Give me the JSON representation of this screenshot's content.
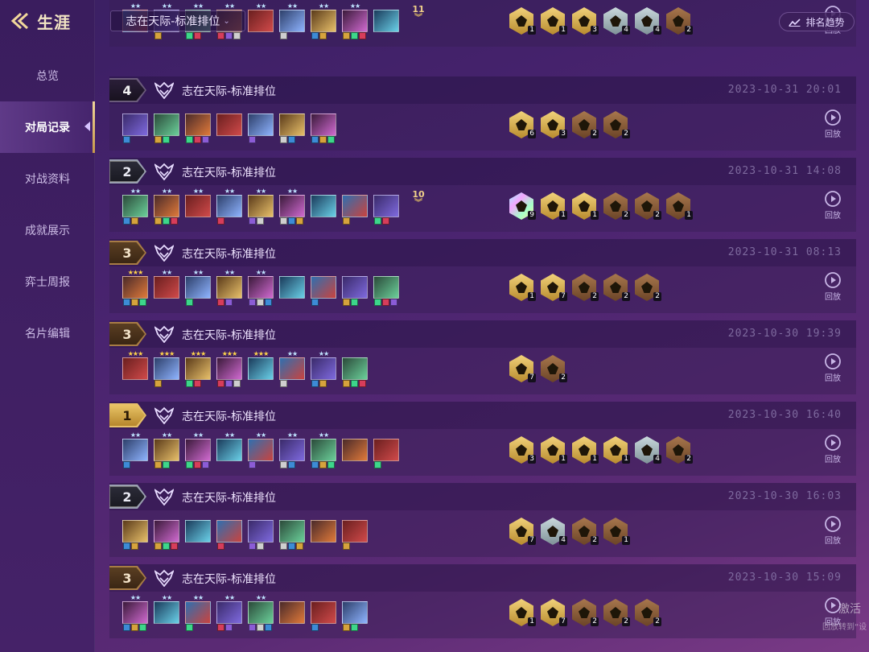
{
  "header": {
    "back_title": "生涯"
  },
  "sidebar": {
    "items": [
      {
        "label": "总览",
        "active": false
      },
      {
        "label": "对局记录",
        "active": true
      },
      {
        "label": "对战资料",
        "active": false
      },
      {
        "label": "成就展示",
        "active": false
      },
      {
        "label": "弈士周报",
        "active": false
      },
      {
        "label": "名片编辑",
        "active": false
      }
    ]
  },
  "topbar": {
    "mode_select": "志在天际-标准排位",
    "trend_button": "排名趋势"
  },
  "replay_label": "回放",
  "matches": [
    {
      "rank": "",
      "mode": "",
      "time": "",
      "units": [
        {
          "stars": 2
        },
        {
          "stars": 2
        },
        {
          "stars": 2
        },
        {
          "stars": 2
        },
        {
          "stars": 2
        },
        {
          "stars": 2
        },
        {
          "stars": 2
        },
        {
          "stars": 2
        },
        {
          "stars": 0
        }
      ],
      "overflow": "11",
      "traits": [
        {
          "tier": "gold",
          "count": "1"
        },
        {
          "tier": "gold",
          "count": "1"
        },
        {
          "tier": "gold",
          "count": "3"
        },
        {
          "tier": "silver",
          "count": "4"
        },
        {
          "tier": "silver",
          "count": "4"
        },
        {
          "tier": "bronze",
          "count": "2"
        }
      ]
    },
    {
      "rank": "4",
      "mode": "志在天际-标准排位",
      "time": "2023-10-31 20:01",
      "units": [
        {
          "stars": 0
        },
        {
          "stars": 0
        },
        {
          "stars": 0
        },
        {
          "stars": 0
        },
        {
          "stars": 0
        },
        {
          "stars": 0
        },
        {
          "stars": 0
        }
      ],
      "overflow": "",
      "traits": [
        {
          "tier": "gold",
          "count": "6"
        },
        {
          "tier": "gold",
          "count": "3"
        },
        {
          "tier": "bronze",
          "count": "2"
        },
        {
          "tier": "bronze",
          "count": "2"
        }
      ]
    },
    {
      "rank": "2",
      "mode": "志在天际-标准排位",
      "time": "2023-10-31 14:08",
      "units": [
        {
          "stars": 2
        },
        {
          "stars": 2
        },
        {
          "stars": 2
        },
        {
          "stars": 2
        },
        {
          "stars": 2
        },
        {
          "stars": 2
        },
        {
          "stars": 0
        },
        {
          "stars": 0
        },
        {
          "stars": 0
        }
      ],
      "overflow": "10",
      "traits": [
        {
          "tier": "prism",
          "count": "9"
        },
        {
          "tier": "gold",
          "count": "1"
        },
        {
          "tier": "gold",
          "count": "1"
        },
        {
          "tier": "bronze",
          "count": "2"
        },
        {
          "tier": "bronze",
          "count": "2"
        },
        {
          "tier": "bronze",
          "count": "1"
        }
      ]
    },
    {
      "rank": "3",
      "mode": "志在天际-标准排位",
      "time": "2023-10-31 08:13",
      "units": [
        {
          "stars": 3
        },
        {
          "stars": 2
        },
        {
          "stars": 2
        },
        {
          "stars": 2
        },
        {
          "stars": 2
        },
        {
          "stars": 0
        },
        {
          "stars": 0
        },
        {
          "stars": 0
        },
        {
          "stars": 0
        }
      ],
      "overflow": "",
      "traits": [
        {
          "tier": "gold",
          "count": "1"
        },
        {
          "tier": "gold",
          "count": "7"
        },
        {
          "tier": "bronze",
          "count": "2"
        },
        {
          "tier": "bronze",
          "count": "2"
        },
        {
          "tier": "bronze",
          "count": "2"
        }
      ]
    },
    {
      "rank": "3",
      "mode": "志在天际-标准排位",
      "time": "2023-10-30 19:39",
      "units": [
        {
          "stars": 3
        },
        {
          "stars": 3
        },
        {
          "stars": 3
        },
        {
          "stars": 3
        },
        {
          "stars": 3
        },
        {
          "stars": 2
        },
        {
          "stars": 2
        },
        {
          "stars": 0
        }
      ],
      "overflow": "",
      "traits": [
        {
          "tier": "gold",
          "count": "7"
        },
        {
          "tier": "bronze",
          "count": "2"
        }
      ]
    },
    {
      "rank": "1",
      "mode": "志在天际-标准排位",
      "time": "2023-10-30 16:40",
      "units": [
        {
          "stars": 2
        },
        {
          "stars": 2
        },
        {
          "stars": 2
        },
        {
          "stars": 2
        },
        {
          "stars": 2
        },
        {
          "stars": 2
        },
        {
          "stars": 2
        },
        {
          "stars": 0
        },
        {
          "stars": 0
        }
      ],
      "overflow": "",
      "traits": [
        {
          "tier": "gold",
          "count": "3"
        },
        {
          "tier": "gold",
          "count": "1"
        },
        {
          "tier": "gold",
          "count": "1"
        },
        {
          "tier": "gold",
          "count": "1"
        },
        {
          "tier": "silver",
          "count": "4"
        },
        {
          "tier": "bronze",
          "count": "2"
        }
      ]
    },
    {
      "rank": "2",
      "mode": "志在天际-标准排位",
      "time": "2023-10-30 16:03",
      "units": [
        {
          "stars": 0
        },
        {
          "stars": 0
        },
        {
          "stars": 0
        },
        {
          "stars": 0
        },
        {
          "stars": 0
        },
        {
          "stars": 0
        },
        {
          "stars": 0
        },
        {
          "stars": 0
        }
      ],
      "overflow": "",
      "traits": [
        {
          "tier": "gold",
          "count": "7"
        },
        {
          "tier": "silver",
          "count": "4"
        },
        {
          "tier": "bronze",
          "count": "2"
        },
        {
          "tier": "bronze",
          "count": "1"
        }
      ]
    },
    {
      "rank": "3",
      "mode": "志在天际-标准排位",
      "time": "2023-10-30 15:09",
      "units": [
        {
          "stars": 2
        },
        {
          "stars": 2
        },
        {
          "stars": 2
        },
        {
          "stars": 2
        },
        {
          "stars": 2
        },
        {
          "stars": 0
        },
        {
          "stars": 0
        },
        {
          "stars": 0
        }
      ],
      "overflow": "",
      "traits": [
        {
          "tier": "gold",
          "count": "1"
        },
        {
          "tier": "gold",
          "count": "7"
        },
        {
          "tier": "bronze",
          "count": "2"
        },
        {
          "tier": "bronze",
          "count": "2"
        },
        {
          "tier": "bronze",
          "count": "2"
        }
      ]
    }
  ],
  "overlay": {
    "line1": "激活",
    "line2": "回放转到“设"
  },
  "colors": {
    "accent_gold": "#e9c466",
    "background": "#4a2470",
    "time_text": "#7e6a9e"
  }
}
